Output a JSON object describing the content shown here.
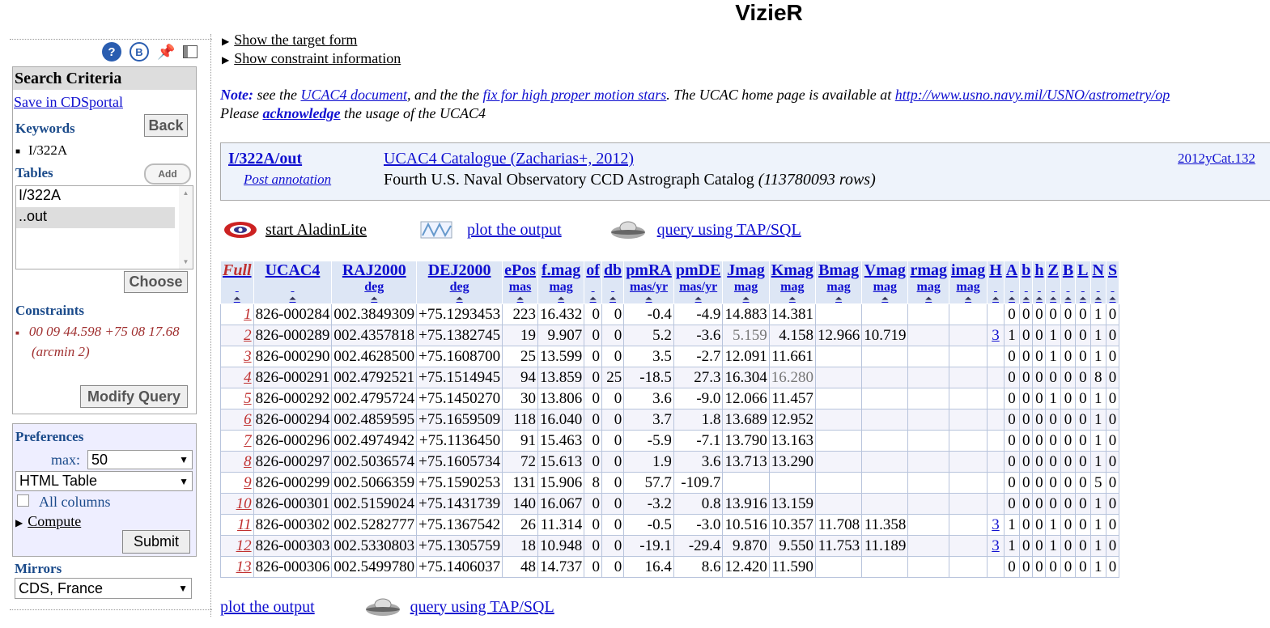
{
  "title": "VizieR",
  "left": {
    "search_criteria": "Search Criteria",
    "save_portal": "Save in CDSportal",
    "keywords_label": "Keywords",
    "back": "Back",
    "keyword": "I/322A",
    "tables_label": "Tables",
    "add": "Add",
    "tables": [
      "I/322A",
      "..out"
    ],
    "choose": "Choose",
    "constraints_label": "Constraints",
    "constraint_text": "00 09 44.598 +75 08 17.68",
    "constraint_radius": "(arcmin 2)",
    "modify": "Modify Query",
    "preferences_label": "Preferences",
    "max_label": "max:",
    "max_value": "50",
    "format_value": "HTML Table",
    "all_columns": "All columns",
    "compute": "Compute",
    "submit": "Submit",
    "mirrors_label": "Mirrors",
    "mirror_value": "CDS, France"
  },
  "main": {
    "show_target": "Show the target form",
    "show_constraint": "Show constraint information",
    "note_label": "Note:",
    "note_1": " see the ",
    "note_link1": "UCAC4 document",
    "note_2": ", and the the ",
    "note_link2": "fix for high proper motion stars",
    "note_3": ". The UCAC home page is available at ",
    "note_link3": "http://www.usno.navy.mil/USNO/astrometry/op",
    "note_4": "Please ",
    "note_ack": "acknowledge",
    "note_5": " the usage of the UCAC4",
    "cat_id": "I/322A/out",
    "cat_post": "Post annotation",
    "cat_title": "UCAC4 Catalogue (Zacharias+, 2012)",
    "cat_desc": "Fourth U.S. Naval Observatory CCD Astrograph Catalog",
    "cat_rows": "(113780093 rows)",
    "cat_ref": "2012yCat.132",
    "aladin": "start AladinLite",
    "plot": "plot the output",
    "tap": "query using TAP/SQL"
  },
  "table": {
    "headers": [
      {
        "name": "Full",
        "unit": ""
      },
      {
        "name": "UCAC4",
        "unit": ""
      },
      {
        "name": "RAJ2000",
        "unit": "deg"
      },
      {
        "name": "DEJ2000",
        "unit": "deg"
      },
      {
        "name": "ePos",
        "unit": "mas"
      },
      {
        "name": "f.mag",
        "unit": "mag"
      },
      {
        "name": "of",
        "unit": ""
      },
      {
        "name": "db",
        "unit": ""
      },
      {
        "name": "pmRA",
        "unit": "mas/yr"
      },
      {
        "name": "pmDE",
        "unit": "mas/yr"
      },
      {
        "name": "Jmag",
        "unit": "mag"
      },
      {
        "name": "Kmag",
        "unit": "mag"
      },
      {
        "name": "Bmag",
        "unit": "mag"
      },
      {
        "name": "Vmag",
        "unit": "mag"
      },
      {
        "name": "rmag",
        "unit": "mag"
      },
      {
        "name": "imag",
        "unit": "mag"
      },
      {
        "name": "H",
        "unit": ""
      },
      {
        "name": "A",
        "unit": ""
      },
      {
        "name": "b",
        "unit": ""
      },
      {
        "name": "h",
        "unit": ""
      },
      {
        "name": "Z",
        "unit": ""
      },
      {
        "name": "B",
        "unit": ""
      },
      {
        "name": "L",
        "unit": ""
      },
      {
        "name": "N",
        "unit": ""
      },
      {
        "name": "S",
        "unit": ""
      }
    ],
    "sort_glyph": "⏶",
    "rows": [
      [
        "1",
        "826-000284",
        "002.3849309",
        "+75.1293453",
        "223",
        "16.432",
        "0",
        "0",
        "-0.4",
        "-4.9",
        "14.883",
        "14.381",
        "",
        "",
        "",
        "",
        "",
        "0",
        "0",
        "0",
        "0",
        "0",
        "0",
        "1",
        "0"
      ],
      [
        "2",
        "826-000289",
        "002.4357818",
        "+75.1382745",
        "19",
        "9.907",
        "0",
        "0",
        "5.2",
        "-3.6",
        "5.159",
        "4.158",
        "12.966",
        "10.719",
        "",
        "",
        "3",
        "1",
        "0",
        "0",
        "1",
        "0",
        "0",
        "1",
        "0"
      ],
      [
        "3",
        "826-000290",
        "002.4628500",
        "+75.1608700",
        "25",
        "13.599",
        "0",
        "0",
        "3.5",
        "-2.7",
        "12.091",
        "11.661",
        "",
        "",
        "",
        "",
        "",
        "0",
        "0",
        "0",
        "1",
        "0",
        "0",
        "1",
        "0"
      ],
      [
        "4",
        "826-000291",
        "002.4792521",
        "+75.1514945",
        "94",
        "13.859",
        "0",
        "25",
        "-18.5",
        "27.3",
        "16.304",
        "16.280",
        "",
        "",
        "",
        "",
        "",
        "0",
        "0",
        "0",
        "0",
        "0",
        "0",
        "8",
        "0"
      ],
      [
        "5",
        "826-000292",
        "002.4795724",
        "+75.1450270",
        "30",
        "13.806",
        "0",
        "0",
        "3.6",
        "-9.0",
        "12.066",
        "11.457",
        "",
        "",
        "",
        "",
        "",
        "0",
        "0",
        "0",
        "1",
        "0",
        "0",
        "1",
        "0"
      ],
      [
        "6",
        "826-000294",
        "002.4859595",
        "+75.1659509",
        "118",
        "16.040",
        "0",
        "0",
        "3.7",
        "1.8",
        "13.689",
        "12.952",
        "",
        "",
        "",
        "",
        "",
        "0",
        "0",
        "0",
        "0",
        "0",
        "0",
        "1",
        "0"
      ],
      [
        "7",
        "826-000296",
        "002.4974942",
        "+75.1136450",
        "91",
        "15.463",
        "0",
        "0",
        "-5.9",
        "-7.1",
        "13.790",
        "13.163",
        "",
        "",
        "",
        "",
        "",
        "0",
        "0",
        "0",
        "0",
        "0",
        "0",
        "1",
        "0"
      ],
      [
        "8",
        "826-000297",
        "002.5036574",
        "+75.1605734",
        "72",
        "15.613",
        "0",
        "0",
        "1.9",
        "3.6",
        "13.713",
        "13.290",
        "",
        "",
        "",
        "",
        "",
        "0",
        "0",
        "0",
        "0",
        "0",
        "0",
        "1",
        "0"
      ],
      [
        "9",
        "826-000299",
        "002.5066359",
        "+75.1590253",
        "131",
        "15.906",
        "8",
        "0",
        "57.7",
        "-109.7",
        "",
        "",
        "",
        "",
        "",
        "",
        "",
        "0",
        "0",
        "0",
        "0",
        "0",
        "0",
        "5",
        "0"
      ],
      [
        "10",
        "826-000301",
        "002.5159024",
        "+75.1431739",
        "140",
        "16.067",
        "0",
        "0",
        "-3.2",
        "0.8",
        "13.916",
        "13.159",
        "",
        "",
        "",
        "",
        "",
        "0",
        "0",
        "0",
        "0",
        "0",
        "0",
        "1",
        "0"
      ],
      [
        "11",
        "826-000302",
        "002.5282777",
        "+75.1367542",
        "26",
        "11.314",
        "0",
        "0",
        "-0.5",
        "-3.0",
        "10.516",
        "10.357",
        "11.708",
        "11.358",
        "",
        "",
        "3",
        "1",
        "0",
        "0",
        "1",
        "0",
        "0",
        "1",
        "0"
      ],
      [
        "12",
        "826-000303",
        "002.5330803",
        "+75.1305759",
        "18",
        "10.948",
        "0",
        "0",
        "-19.1",
        "-29.4",
        "9.870",
        "9.550",
        "11.753",
        "11.189",
        "",
        "",
        "3",
        "1",
        "0",
        "0",
        "1",
        "0",
        "0",
        "1",
        "0"
      ],
      [
        "13",
        "826-000306",
        "002.5499780",
        "+75.1406037",
        "48",
        "14.737",
        "0",
        "0",
        "16.4",
        "8.6",
        "12.420",
        "11.590",
        "",
        "",
        "",
        "",
        "",
        "0",
        "0",
        "0",
        "0",
        "0",
        "0",
        "1",
        "0"
      ]
    ],
    "grey_cells": [
      [
        1,
        10
      ],
      [
        3,
        11
      ]
    ]
  },
  "bottom": {
    "plot": "plot the output",
    "tap": "query using TAP/SQL"
  }
}
